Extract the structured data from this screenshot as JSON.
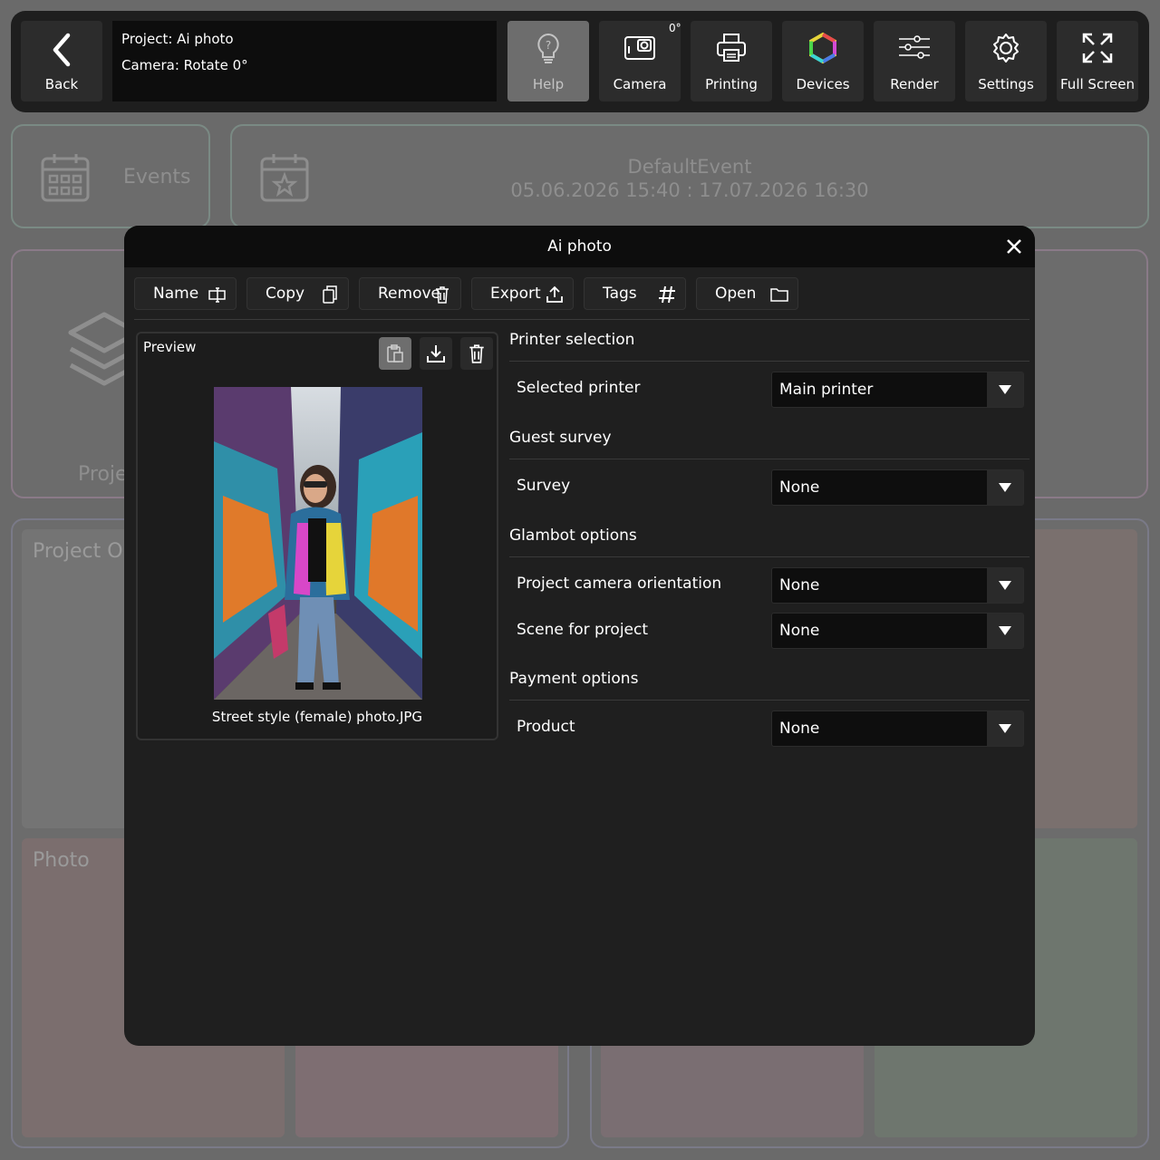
{
  "topbar": {
    "back_label": "Back",
    "project_line": "Project: Ai photo",
    "camera_line": "Camera: Rotate 0°",
    "camera_rotation_badge": "0°",
    "buttons": [
      {
        "label": "Help",
        "icon": "help-bulb-icon"
      },
      {
        "label": "Camera",
        "icon": "camera-icon"
      },
      {
        "label": "Printing",
        "icon": "printer-icon"
      },
      {
        "label": "Devices",
        "icon": "devices-hexagon-icon"
      },
      {
        "label": "Render",
        "icon": "sliders-icon"
      },
      {
        "label": "Settings",
        "icon": "gear-icon"
      },
      {
        "label": "Full Screen",
        "icon": "fullscreen-icon"
      }
    ]
  },
  "background": {
    "events_label": "Events",
    "event_name": "DefaultEvent",
    "event_range": "05.06.2026 15:40 : 17.07.2026 16:30",
    "projects_label": "Projec",
    "project_options_label": "Project Opt",
    "photo_label": "Photo"
  },
  "dialog": {
    "title": "Ai photo",
    "toolbar": [
      {
        "label": "Name",
        "icon": "rename-icon"
      },
      {
        "label": "Copy",
        "icon": "copy-icon"
      },
      {
        "label": "Remove",
        "icon": "trash-icon"
      },
      {
        "label": "Export",
        "icon": "export-icon"
      },
      {
        "label": "Tags",
        "icon": "hashtag-icon"
      },
      {
        "label": "Open",
        "icon": "folder-icon"
      }
    ],
    "preview": {
      "title": "Preview",
      "filename": "Street style (female) photo.JPG"
    },
    "sections": {
      "printer": "Printer selection",
      "survey": "Guest survey",
      "glambot": "Glambot options",
      "payment": "Payment options"
    },
    "fields": {
      "selected_printer_label": "Selected printer",
      "selected_printer_value": "Main printer",
      "survey_label": "Survey",
      "survey_value": "None",
      "orientation_label": "Project camera orientation",
      "orientation_value": "None",
      "scene_label": "Scene for project",
      "scene_value": "None",
      "product_label": "Product",
      "product_value": "None"
    }
  }
}
